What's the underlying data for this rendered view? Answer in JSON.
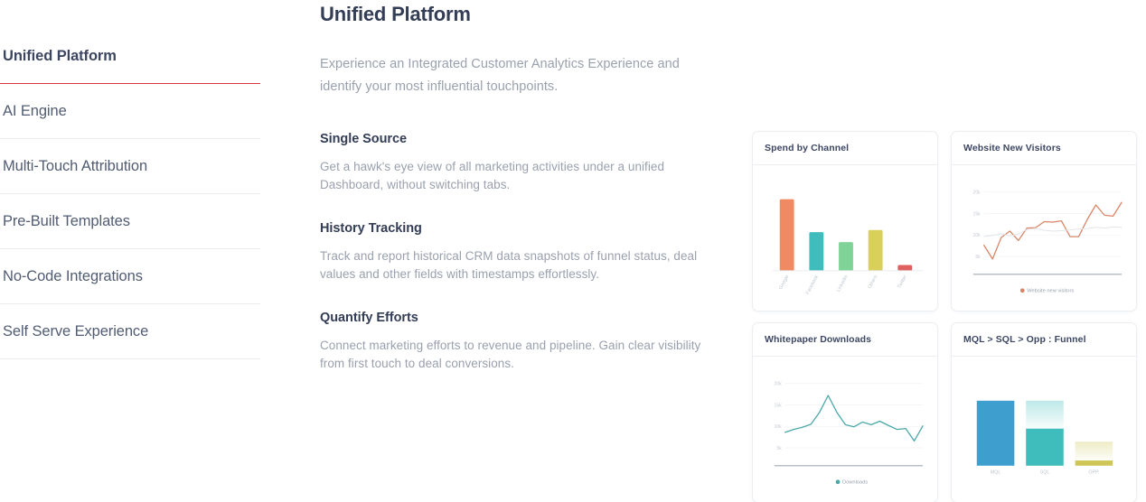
{
  "sidebar": {
    "items": [
      {
        "label": "Unified Platform",
        "active": true
      },
      {
        "label": "AI Engine",
        "active": false
      },
      {
        "label": "Multi-Touch Attribution",
        "active": false
      },
      {
        "label": "Pre-Built Templates",
        "active": false
      },
      {
        "label": "No-Code Integrations",
        "active": false
      },
      {
        "label": "Self Serve Experience",
        "active": false
      }
    ],
    "active_accent": "#e0323c"
  },
  "main": {
    "title": "Unified Platform",
    "intro": "Experience an Integrated Customer Analytics Experience and identify your most influential touchpoints.",
    "features": [
      {
        "title": "Single Source",
        "desc": "Get a hawk's eye view of all marketing activities under a unified Dashboard, without switching tabs."
      },
      {
        "title": "History Tracking",
        "desc": "Track and report historical CRM data snapshots of funnel status, deal values and other fields with timestamps effortlessly."
      },
      {
        "title": "Quantify Efforts",
        "desc": "Connect marketing efforts to revenue and pipeline. Gain clear visibility from first touch to deal conversions."
      }
    ]
  },
  "dashboard": {
    "cards": [
      {
        "title": "Spend by Channel"
      },
      {
        "title": "Website New Visitors"
      },
      {
        "title": "Whitepaper Downloads"
      },
      {
        "title": "MQL > SQL > Opp : Funnel"
      }
    ]
  },
  "chart_data": [
    {
      "type": "bar",
      "title": "Spend by Channel",
      "categories": [
        "Google",
        "Facebook",
        "LinkedIn",
        "Others",
        "Twitter"
      ],
      "values": [
        100,
        54,
        40,
        57,
        8
      ],
      "colors": [
        "#ef8a62",
        "#3fbcbc",
        "#80d397",
        "#d8d05a",
        "#e06060"
      ],
      "xlabel": "",
      "ylabel": "",
      "ylim": [
        0,
        110
      ],
      "grid": false,
      "legend": "none"
    },
    {
      "type": "line",
      "title": "Website New Visitors",
      "x": [
        1,
        2,
        3,
        4,
        5,
        6,
        7,
        8,
        9,
        10,
        11,
        12,
        13,
        14,
        15,
        16,
        17
      ],
      "ylim": [
        2500,
        20000
      ],
      "yticks": [
        5000,
        10000,
        15000,
        20000
      ],
      "ytick_labels": [
        "5k",
        "10k",
        "15k",
        "20k"
      ],
      "grid": true,
      "legend": "bottom",
      "series": [
        {
          "name": "Website new visitors",
          "color": "#d98566",
          "values": [
            7600,
            4400,
            9400,
            10900,
            8700,
            11600,
            11700,
            13100,
            13000,
            13300,
            9600,
            9600,
            13600,
            17000,
            14600,
            14400,
            17600
          ]
        },
        {
          "name": "",
          "color": "#e2e6ea",
          "values": [
            9600,
            9900,
            10300,
            9800,
            10200,
            11300,
            11500,
            11100,
            10900,
            11000,
            11200,
            11400,
            11500,
            11800,
            11600,
            11900,
            11800
          ]
        }
      ]
    },
    {
      "type": "line",
      "title": "Whitepaper Downloads",
      "x": [
        1,
        2,
        3,
        4,
        5,
        6,
        7,
        8,
        9,
        10,
        11,
        12,
        13,
        14,
        15,
        16,
        17
      ],
      "ylim": [
        2500,
        20000
      ],
      "yticks": [
        5000,
        10000,
        15000,
        20000
      ],
      "ytick_labels": [
        "5k",
        "10k",
        "15k",
        "20k"
      ],
      "grid": true,
      "legend": "bottom",
      "series": [
        {
          "name": "Downloads",
          "color": "#4aa8a8",
          "values": [
            8600,
            9300,
            9800,
            10500,
            13300,
            17200,
            13300,
            10400,
            9900,
            11000,
            10400,
            11200,
            10200,
            9300,
            9500,
            6600,
            10100
          ]
        }
      ]
    },
    {
      "type": "bar",
      "title": "MQL > SQL > Opp : Funnel",
      "categories": [
        "MQL",
        "SQL",
        "OPP."
      ],
      "values": [
        100,
        57,
        8
      ],
      "tops": [
        100,
        100,
        37
      ],
      "colors": [
        "#3e9fce",
        "#3fbcbc",
        "#cec758"
      ],
      "xlabel": "",
      "ylabel": "",
      "ylim": [
        0,
        110
      ],
      "grid": false,
      "legend": "none",
      "note": "funnel: solid fill = stage value, faded gradient above = drop-off from previous stage"
    }
  ]
}
